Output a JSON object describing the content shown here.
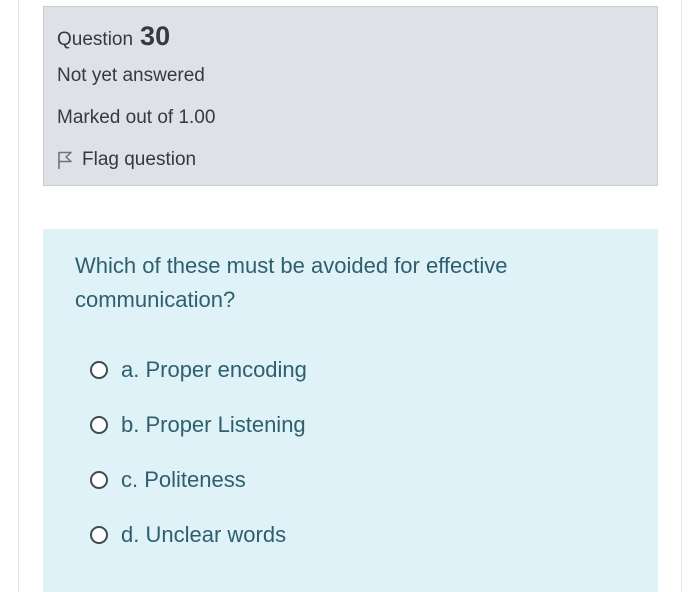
{
  "question_info": {
    "question_word": "Question",
    "question_number": "30",
    "state": "Not yet answered",
    "grade": "Marked out of 1.00",
    "flag_label": "Flag question",
    "flag_icon": "flag-icon"
  },
  "question": {
    "text": "Which of these must be avoided for effective communication?",
    "options": [
      {
        "label": "a. Proper encoding",
        "selected": false
      },
      {
        "label": "b. Proper Listening",
        "selected": false
      },
      {
        "label": "c. Politeness",
        "selected": false
      },
      {
        "label": "d. Unclear words",
        "selected": false
      }
    ]
  },
  "colors": {
    "info_background": "#dee2e6",
    "formulation_background": "#def2f8",
    "question_text": "#2f5f6e"
  }
}
